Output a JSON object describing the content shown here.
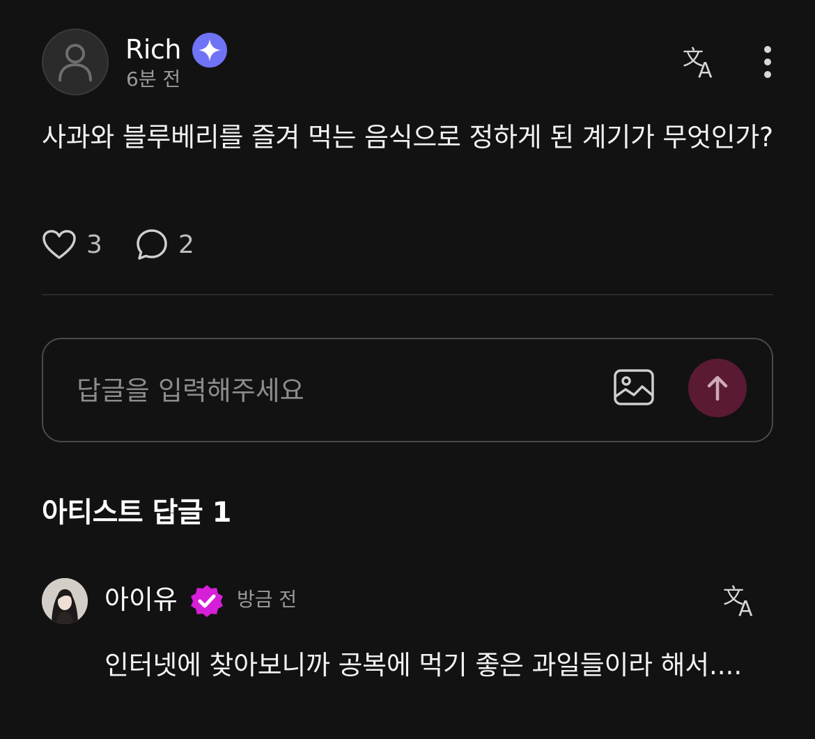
{
  "post": {
    "author": "Rich",
    "time": "6분 전",
    "body": "사과와 블루베리를 즐겨 먹는 음식으로 정하게 된 계기가 무엇인가?",
    "like_count": "3",
    "comment_count": "2"
  },
  "reply_input": {
    "placeholder": "답글을 입력해주세요"
  },
  "section": {
    "title": "아티스트 답글 1"
  },
  "artist_reply": {
    "name": "아이유",
    "time": "방금 전",
    "body": "인터넷에 찾아보니까 공복에 먹기 좋은 과일들이라 해서...."
  },
  "colors": {
    "background": "#121212",
    "sparkle_badge": "#6f73f5",
    "verified_badge": "#d61fd8",
    "send_button": "#5a1a34",
    "muted_text": "#9a9a9a"
  },
  "icons": {
    "author_badge": "sparkle-badge-icon",
    "translate": "translate-icon",
    "more": "more-vertical-icon",
    "like": "heart-icon",
    "comment": "comment-bubble-icon",
    "image": "image-icon",
    "send": "arrow-up-icon",
    "artist_badge": "verified-badge-icon"
  }
}
